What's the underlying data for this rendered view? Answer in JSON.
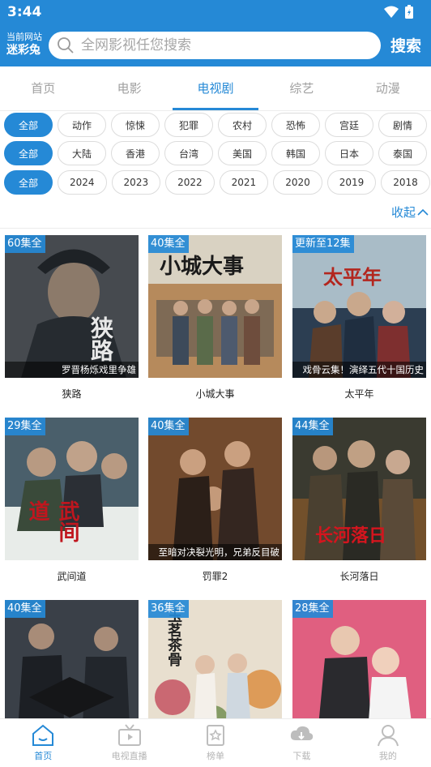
{
  "status": {
    "time": "3:44"
  },
  "header": {
    "site_label_line1": "当前网站",
    "site_label_line2": "迷彩兔",
    "search_placeholder": "全网影视任您搜索",
    "search_button": "搜索"
  },
  "tabs": [
    {
      "label": "首页"
    },
    {
      "label": "电影"
    },
    {
      "label": "电视剧"
    },
    {
      "label": "综艺"
    },
    {
      "label": "动漫"
    }
  ],
  "active_tab": "电视剧",
  "filters": {
    "genre": [
      "全部",
      "动作",
      "惊悚",
      "犯罪",
      "农村",
      "恐怖",
      "宫廷",
      "剧情"
    ],
    "region": [
      "全部",
      "大陆",
      "香港",
      "台湾",
      "美国",
      "韩国",
      "日本",
      "泰国"
    ],
    "year": [
      "全部",
      "2024",
      "2023",
      "2022",
      "2021",
      "2020",
      "2019",
      "2018"
    ],
    "collapse_label": "收起"
  },
  "items": [
    {
      "title": "狭路",
      "badge": "60集全",
      "caption": "罗晋杨烁戏里争雄",
      "poster_text": "狭路"
    },
    {
      "title": "小城大事",
      "badge": "40集全",
      "caption": "",
      "poster_text": "小城大事"
    },
    {
      "title": "太平年",
      "badge": "更新至12集",
      "caption": "戏骨云集！演绎五代十国历史",
      "poster_text": "太平年"
    },
    {
      "title": "武间道",
      "badge": "29集全",
      "caption": "",
      "poster_text": "武间道"
    },
    {
      "title": "罚罪2",
      "badge": "40集全",
      "caption": "至暗对决裂光明，兄弟反目破",
      "poster_text": ""
    },
    {
      "title": "长河落日",
      "badge": "44集全",
      "caption": "",
      "poster_text": "长河落日"
    },
    {
      "title": "",
      "badge": "40集全",
      "caption": "",
      "poster_text": ""
    },
    {
      "title": "",
      "badge": "36集全",
      "caption": "",
      "poster_text": "玉茗茶骨"
    },
    {
      "title": "",
      "badge": "28集全",
      "caption": "",
      "poster_text": ""
    }
  ],
  "bottom_nav": [
    {
      "label": "首页",
      "icon": "home-icon",
      "active": true
    },
    {
      "label": "电视直播",
      "icon": "tv-icon",
      "active": false
    },
    {
      "label": "榜单",
      "icon": "ranking-icon",
      "active": false
    },
    {
      "label": "下载",
      "icon": "download-icon",
      "active": false
    },
    {
      "label": "我的",
      "icon": "profile-icon",
      "active": false
    }
  ],
  "colors": {
    "accent": "#2589d6",
    "inactive": "#a0a0a0"
  }
}
